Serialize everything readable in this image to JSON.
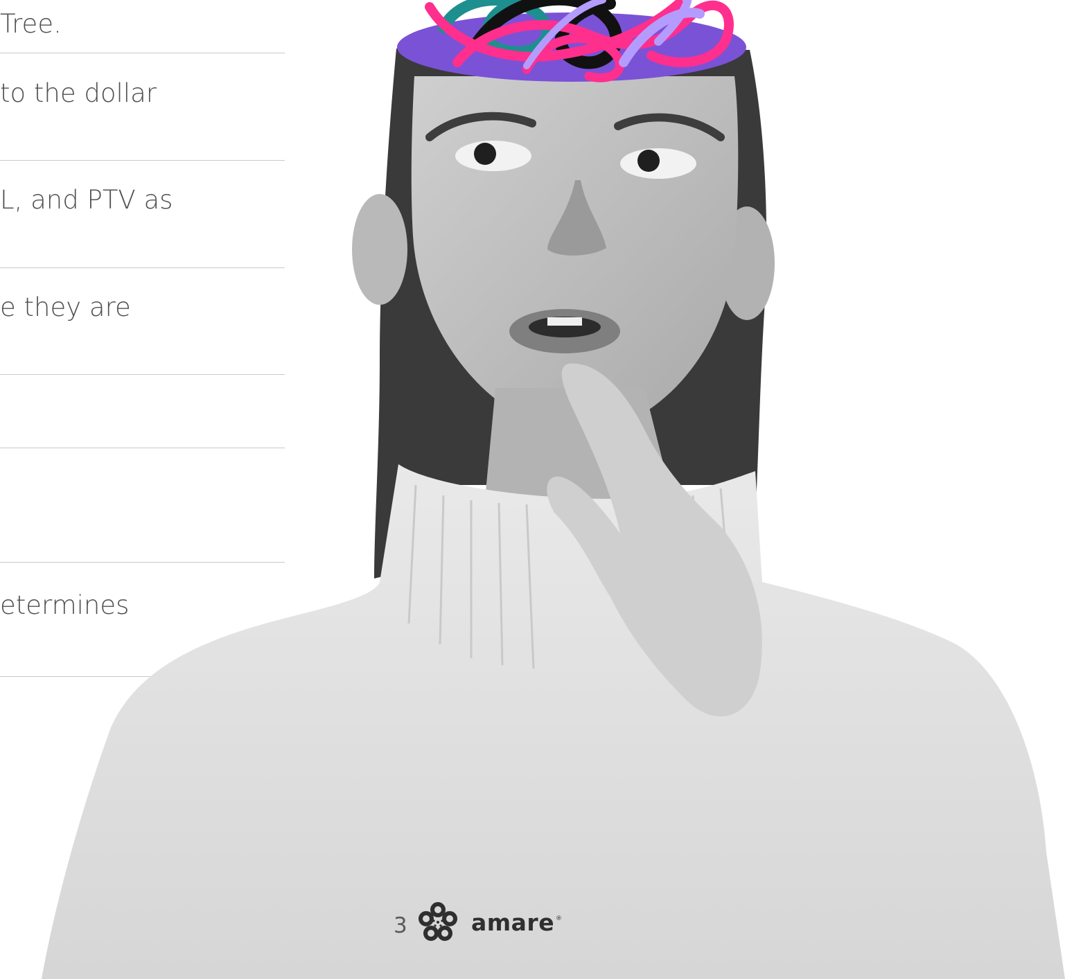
{
  "text_list": {
    "rows": [
      "Tree.",
      "to the dollar",
      "L, and PTV as",
      "e they are",
      "",
      "",
      "etermines"
    ]
  },
  "footer": {
    "page_number": "3",
    "brand_name": "amare",
    "brand_mark": "®"
  },
  "illustration": {
    "subject": "woman-thinking-photo",
    "scribble_colors": [
      "#ff2f8e",
      "#7b5cd9",
      "#b49cff",
      "#1d8f8f",
      "#111111"
    ],
    "head_opening_color": "#7a52d6"
  }
}
